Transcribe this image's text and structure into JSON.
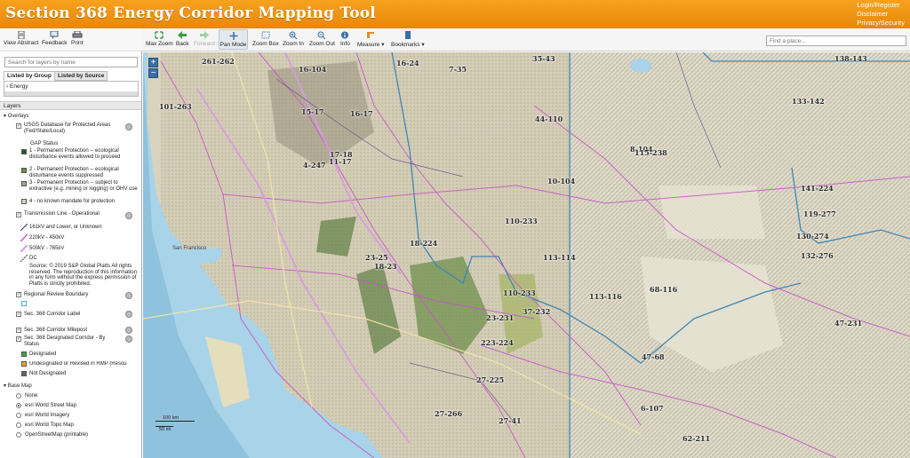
{
  "app": {
    "title": "Section 368 Energy Corridor Mapping Tool"
  },
  "header_links": {
    "login": "Login/Register",
    "disclaimer": "Disclaimer",
    "privacy": "Privacy/Security"
  },
  "left_tools": {
    "view_abstract": "View Abstract",
    "feedback": "Feedback",
    "print": "Print"
  },
  "toolbar": {
    "max_zoom": "Max Zoom",
    "back": "Back",
    "forward": "Forward",
    "pan_mode": "Pan Mode",
    "zoom_box": "Zoom Box",
    "zoom_in": "Zoom In",
    "zoom_out": "Zoom Out",
    "info": "Info",
    "measure": "Measure",
    "bookmarks": "Bookmarks",
    "find_place_placeholder": "Find a place..."
  },
  "layer_panel": {
    "search_placeholder": "Search for layers by name",
    "tab_group": "Listed by Group",
    "tab_source": "Listed by Source",
    "group_item": "Energy",
    "layers_header": "Layers",
    "overlays": "Overlays",
    "usgs": {
      "title": "USGS Database for Protected Areas (Fed/State/Local)",
      "sub": "GAP Status",
      "items": [
        "1 - Permanent Protection -- ecological disturbance events allowed to proceed",
        "2 - Permanent Protection -- ecological disturbance events suppressed",
        "3 - Permanent Protection -- subject to extractive (e.g. mining or logging) or OHV use",
        "4 - no known mandate for protection"
      ]
    },
    "transmission": {
      "title": "Transmission Line - Operational",
      "items": [
        "161kV and Lower, or Unknown",
        "220kV - 450kV",
        "500kV - 765kV",
        "DC"
      ],
      "source": "Source: © 2019 S&P Global Platts All rights reserved. The reproduction of this information in any form without the express permission of Platts is strictly prohibited."
    },
    "regional_review": "Regional Review Boundary",
    "corridor_label": "Sec. 368 Corridor Label",
    "corridor_milepost": "Sec. 368 Corridor Milepost",
    "designated": {
      "title": "Sec. 368 Designated Corridor - By Status",
      "items": [
        "Designated",
        "Undesignated or Revised in RMP (Resou",
        "Not Designated"
      ]
    },
    "base_map": "Base Map",
    "base_options": [
      "None",
      "esri World Street Map",
      "esri World Imagery",
      "esri World Topo Map",
      "OpenStreetMap (printable)"
    ]
  },
  "map": {
    "zoom_in_label": "+",
    "zoom_out_label": "−",
    "scale_top": "100 km",
    "scale_bottom": "50 mi",
    "city_sf": "San Francisco",
    "labels": [
      "261-262",
      "16-24",
      "7-35",
      "35-43",
      "101-263",
      "15-17",
      "16-17",
      "44-110",
      "11-17",
      "4-247",
      "101-263",
      "18-224",
      "110-233",
      "113-114",
      "113-116",
      "18-23",
      "23-231",
      "37-232",
      "223-224",
      "27-225",
      "27-266",
      "27-41",
      "8-104",
      "68-116",
      "47-68",
      "6-107",
      "62-211",
      "133-142",
      "138-143",
      "141-224",
      "119-277",
      "130-274",
      "132-276",
      "115-238",
      "23-25",
      "17-18",
      "16-104",
      "10-104",
      "110-233",
      "47-231"
    ]
  },
  "colors": {
    "header": "#ee8f12",
    "accent_blue": "#3b6ea5",
    "protect1": "#1f5a2a",
    "protect2": "#6b8f3a",
    "protect3": "#a6a294",
    "protect4": "#d7d2c0",
    "line_lo": "#4b2a7a",
    "line_220": "#c658c6",
    "line_500": "#d89ae0",
    "designated": "#3aa63a",
    "undesignated": "#f0a32c",
    "not_designated": "#666"
  }
}
